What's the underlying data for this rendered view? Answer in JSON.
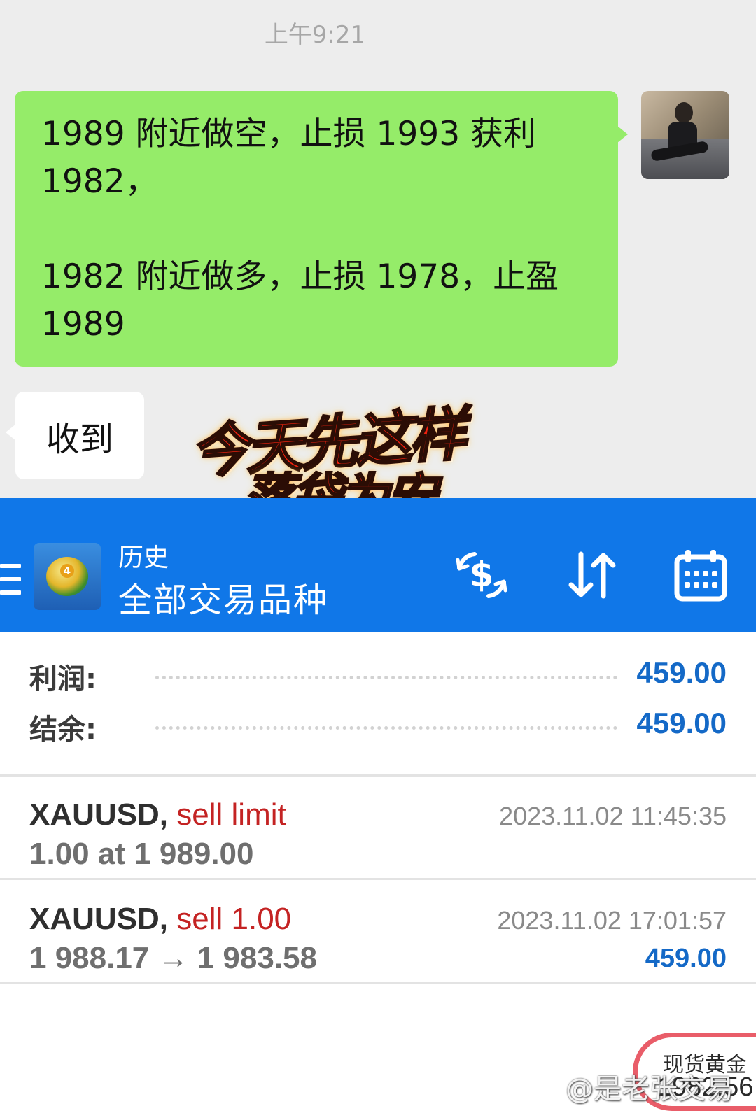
{
  "chat": {
    "time": "上午9:21",
    "outgoing_message": {
      "line1": "1989 附近做空，止损 1993 获利",
      "line2": "1982，",
      "line3": "1982 附近做多，止损 1978，止盈",
      "line4": "1989"
    },
    "incoming_message": "收到",
    "sticker": {
      "line1": "今天先这样了",
      "line2": "落袋为安"
    }
  },
  "header": {
    "subtitle": "历史",
    "title": "全部交易品种",
    "icons": [
      "menu-icon",
      "app-logo",
      "dollar-exchange-icon",
      "sort-icon",
      "calendar-icon"
    ]
  },
  "summary": {
    "profit_label": "利润:",
    "profit_value": "459.00",
    "balance_label": "结余:",
    "balance_value": "459.00"
  },
  "deals": [
    {
      "symbol": "XAUUSD,",
      "type": "sell limit",
      "detail": "1.00 at 1 989.00",
      "time": "2023.11.02 11:45:35",
      "profit": ""
    },
    {
      "symbol": "XAUUSD,",
      "type": "sell 1.00",
      "detail": "1 988.17 → 1 983.58",
      "time": "2023.11.02 17:01:57",
      "profit": "459.00"
    }
  ],
  "gold_badge": {
    "name": "现货黄金",
    "price": "1982.56"
  },
  "watermark": "@是老张交易",
  "colors": {
    "chat_background": "#ededed",
    "outgoing_bubble": "#95ec69",
    "header_blue": "#1077e8",
    "profit_blue": "#1469c7",
    "sell_red": "#c42323",
    "badge_border": "#e95d69"
  }
}
